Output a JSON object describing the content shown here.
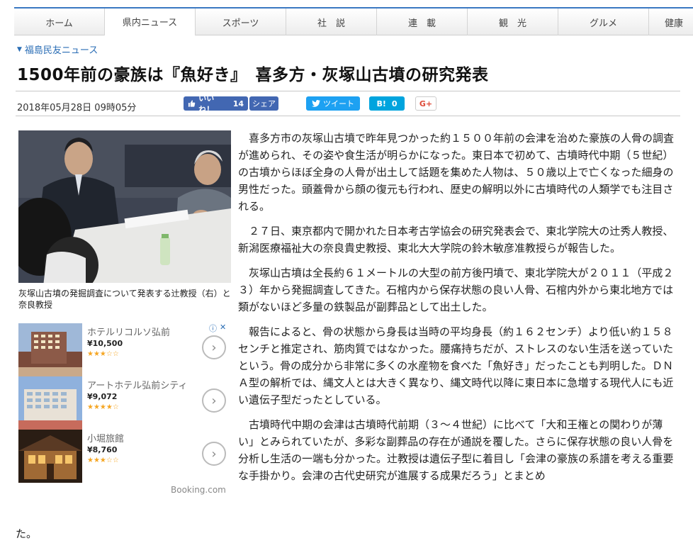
{
  "nav": {
    "items": [
      {
        "label": "ホーム"
      },
      {
        "label": "県内ニュース",
        "active": true
      },
      {
        "label": "スポーツ"
      },
      {
        "label": "社　説"
      },
      {
        "label": "連　載"
      },
      {
        "label": "観　光"
      },
      {
        "label": "グルメ"
      },
      {
        "label": "健康"
      }
    ]
  },
  "source": {
    "label": "福島民友ニュース",
    "icon": "triangle-down-icon"
  },
  "article": {
    "title": "1500年前の豪族は『魚好き』　喜多方・灰塚山古墳の研究発表",
    "date": "2018年05月28日 09時05分",
    "photo_caption": "灰塚山古墳の発掘調査について発表する辻教授（右）と奈良教授",
    "paragraphs": [
      "喜多方市の灰塚山古墳で昨年見つかった約１５００年前の会津を治めた豪族の人骨の調査が進められ、その姿や食生活が明らかになった。東日本で初めて、古墳時代中期（５世紀）の古墳からほぼ全身の人骨が出土して話題を集めた人物は、５０歳以上で亡くなった細身の男性だった。頭蓋骨から顔の復元も行われ、歴史の解明以外に古墳時代の人類学でも注目される。",
      "２７日、東京都内で開かれた日本考古学協会の研究発表会で、東北学院大の辻秀人教授、新潟医療福祉大の奈良貴史教授、東北大大学院の鈴木敏彦准教授らが報告した。",
      "灰塚山古墳は全長約６１メートルの大型の前方後円墳で、東北学院大が２０１１（平成２３）年から発掘調査してきた。石棺内から保存状態の良い人骨、石棺内外から東北地方では類がないほど多量の鉄製品が副葬品として出土した。",
      "報告によると、骨の状態から身長は当時の平均身長（約１６２センチ）より低い約１５８センチと推定され、筋肉質ではなかった。腰痛持ちだが、ストレスのない生活を送っていたという。骨の成分から非常に多くの水産物を食べた「魚好き」だったことも判明した。ＤＮＡ型の解析では、縄文人とは大きく異なり、縄文時代以降に東日本に急増する現代人にも近い遺伝子型だったとしている。",
      "古墳時代中期の会津は古墳時代前期（３～４世紀）に比べて「大和王権との関わりが薄い」とみられていたが、多彩な副葬品の存在が通説を覆した。さらに保存状態の良い人骨を分析し生活の一端も分かった。辻教授は遺伝子型に着目し「会津の豪族の系譜を考える重要な手掛かり。会津の古代史研究が進展する成果だろう」とまとめ"
    ],
    "paragraph_tail": "た。"
  },
  "social": {
    "fb_like": {
      "label": "いいね！",
      "count": "14",
      "icon": "thumbs-up-icon"
    },
    "fb_share": {
      "label": "シェア"
    },
    "tweet": {
      "label": "ツイート",
      "icon": "twitter-bird-icon"
    },
    "hatena": {
      "label": "B!",
      "count": "0"
    },
    "gplus": {
      "label": "G+"
    }
  },
  "ads": {
    "choices_icon": "info-icon",
    "close_icon": "close-icon",
    "items": [
      {
        "name": "ホテルリコルソ弘前",
        "price": "¥10,500",
        "rating": 3,
        "stars": "★★★☆☆"
      },
      {
        "name": "アートホテル弘前シティ",
        "price": "¥9,072",
        "rating": 4,
        "stars": "★★★★☆"
      },
      {
        "name": "小堀旅館",
        "price": "¥8,760",
        "rating": 3,
        "stars": "★★★☆☆"
      }
    ],
    "provider": "Booking.com"
  },
  "colors": {
    "nav_accent": "#3a78c2",
    "link": "#2a6db5",
    "facebook": "#4267b2",
    "twitter": "#1da1f2",
    "hatena": "#00a4de",
    "gplus": "#dd4b39",
    "star": "#f5a623"
  }
}
